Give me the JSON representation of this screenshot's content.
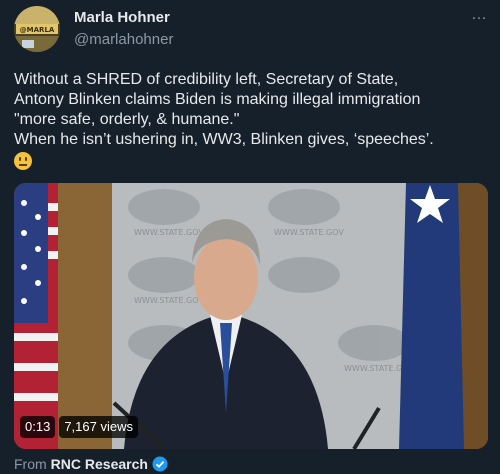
{
  "author": {
    "name": "Marla Hohner",
    "handle": "@marlahohner",
    "avatar_text": "@MARLA"
  },
  "more_icon": "…",
  "tweet": {
    "line1": "Without a SHRED of credibility left, Secretary of State,",
    "line2": "Antony Blinken claims Biden is making illegal immigration",
    "line3": "\"more safe, orderly, & humane.\"",
    "line4": "When he isn’t ushering in, WW3, Blinken gives, ‘speeches’.",
    "emoji": "neutral-face-emoji"
  },
  "video": {
    "time": "0:13",
    "views": "7,167 views",
    "backdrop_text": "WWW.STATE.GOV"
  },
  "attribution": {
    "prefix": "From",
    "source": "RNC Research",
    "badge": "verified-badge-icon"
  },
  "colors": {
    "background": "#15202b",
    "text": "#e7e9ea",
    "secondary": "#8b98a5",
    "verified": "#1d9bf0"
  }
}
